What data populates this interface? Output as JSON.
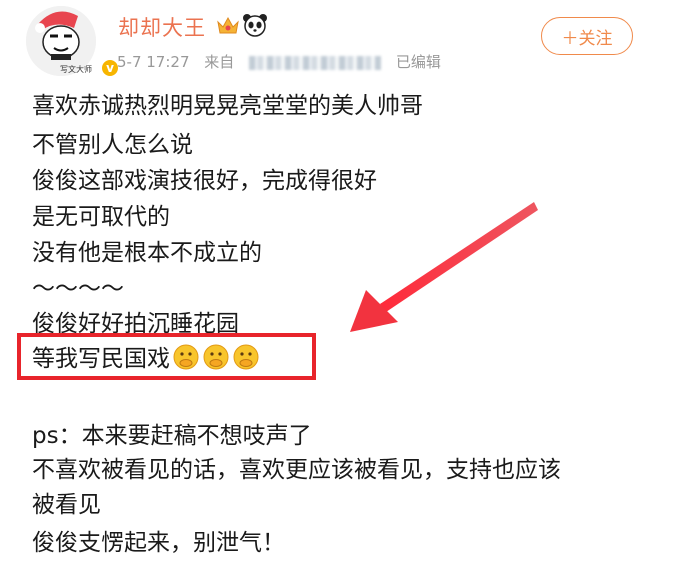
{
  "header": {
    "username": "却却大王",
    "avatar_caption": "写文大师",
    "verified_badge": "v",
    "timestamp": "5-7 17:27",
    "source_prefix": "来自",
    "edited_label": "已编辑",
    "follow_label": "＋关注",
    "icons": [
      "avatar-image",
      "crown-icon",
      "panda-icon",
      "verified-badge-icon"
    ]
  },
  "post": {
    "lines": [
      "喜欢赤诚热烈明晃晃亮堂堂的美人帅哥",
      "不管别人怎么说",
      "俊俊这部戏演技很好，完成得很好",
      "是无可取代的",
      "没有他是根本不成立的",
      "～～～～",
      "俊俊好好拍沉睡花园",
      "等我写民国戏",
      "",
      "ps：本来要赶稿不想吱声了",
      "不喜欢被看见的话，喜欢更应该被看见，支持也应该",
      "被看见",
      "俊俊支愣起来，别泄气！"
    ],
    "highlight_line_emoji": [
      "thinking-emoji",
      "thinking-emoji",
      "thinking-emoji"
    ]
  },
  "annotation": {
    "highlight_color": "#e8242b",
    "arrow_color": "#f2333f"
  },
  "colors": {
    "username": "#eb7350",
    "meta": "#999999",
    "follow": "#f08a4b"
  }
}
